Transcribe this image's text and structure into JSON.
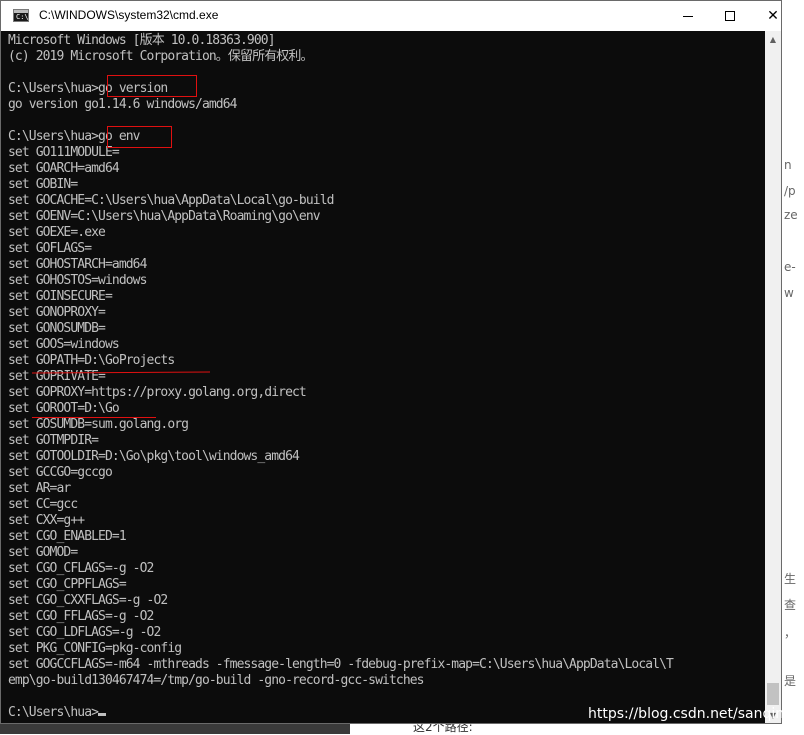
{
  "window": {
    "title": "C:\\WINDOWS\\system32\\cmd.exe",
    "icon_label": "C:\\",
    "buttons": {
      "minimize": "minimize",
      "maximize": "maximize",
      "close": "✕"
    }
  },
  "console": {
    "lines": [
      "Microsoft Windows [版本 10.0.18363.900]",
      "(c) 2019 Microsoft Corporation。保留所有权利。",
      "",
      "C:\\Users\\hua>go version",
      "go version go1.14.6 windows/amd64",
      "",
      "C:\\Users\\hua>go env",
      "set GO111MODULE=",
      "set GOARCH=amd64",
      "set GOBIN=",
      "set GOCACHE=C:\\Users\\hua\\AppData\\Local\\go-build",
      "set GOENV=C:\\Users\\hua\\AppData\\Roaming\\go\\env",
      "set GOEXE=.exe",
      "set GOFLAGS=",
      "set GOHOSTARCH=amd64",
      "set GOHOSTOS=windows",
      "set GOINSECURE=",
      "set GONOPROXY=",
      "set GONOSUMDB=",
      "set GOOS=windows",
      "set GOPATH=D:\\GoProjects",
      "set GOPRIVATE=",
      "set GOPROXY=https://proxy.golang.org,direct",
      "set GOROOT=D:\\Go",
      "set GOSUMDB=sum.golang.org",
      "set GOTMPDIR=",
      "set GOTOOLDIR=D:\\Go\\pkg\\tool\\windows_amd64",
      "set GCCGO=gccgo",
      "set AR=ar",
      "set CC=gcc",
      "set CXX=g++",
      "set CGO_ENABLED=1",
      "set GOMOD=",
      "set CGO_CFLAGS=-g -O2",
      "set CGO_CPPFLAGS=",
      "set CGO_CXXFLAGS=-g -O2",
      "set CGO_FFLAGS=-g -O2",
      "set CGO_LDFLAGS=-g -O2",
      "set PKG_CONFIG=pkg-config",
      "set GOGCCFLAGS=-m64 -mthreads -fmessage-length=0 -fdebug-prefix-map=C:\\Users\\hua\\AppData\\Local\\T",
      "emp\\go-build130467474=/tmp/go-build -gno-record-gcc-switches",
      ""
    ],
    "prompt": "C:\\Users\\hua>"
  },
  "watermark": "https://blog.csdn.net/sanqin",
  "background": {
    "right_fragments": [
      "n",
      "/p",
      "ze",
      "e-",
      "w",
      "生",
      "查",
      "，",
      "是"
    ],
    "bottom_text": "这2个路径:"
  },
  "colors": {
    "console_bg": "#0c0c0c",
    "console_fg": "#c0c0c0",
    "annotation": "#e01010",
    "titlebar_bg": "#ffffff"
  }
}
